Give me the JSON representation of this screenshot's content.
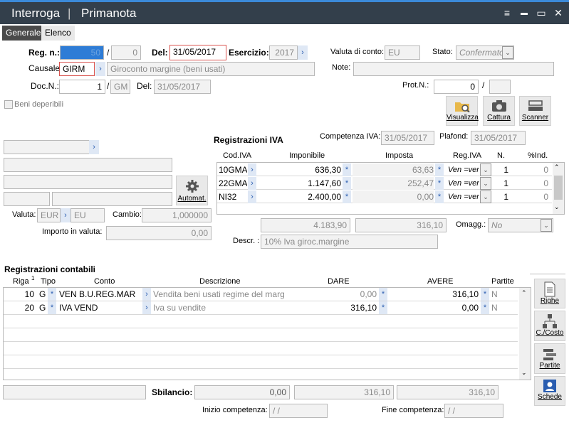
{
  "title": {
    "left": "Interroga",
    "sep": "|",
    "right": "Primanota"
  },
  "window_controls": {
    "menu": "≡",
    "minimize": "▬",
    "restore": "▭",
    "close": "✕"
  },
  "tabs": [
    {
      "label": "Generale"
    },
    {
      "label": "Elenco"
    }
  ],
  "header": {
    "reg_label": "Reg. n.:",
    "reg_value": "50",
    "slash": "/",
    "reg_suffix": "0",
    "del_label": "Del:",
    "del_value": "31/05/2017",
    "esercizio_label": "Esercizio:",
    "esercizio_value": "2017",
    "valuta_conto_label": "Valuta di conto:",
    "valuta_conto_value": "EU",
    "stato_label": "Stato:",
    "stato_value": "Confermato",
    "causale_label": "Causale:",
    "causale_code": "GIRM",
    "causale_desc": "Giroconto margine (beni usati)",
    "note_label": "Note:",
    "doc_label": "Doc.N.:",
    "doc_value": "1",
    "doc_series": "GM",
    "doc_del_label": "Del:",
    "doc_del_value": "31/05/2017",
    "prot_label": "Prot.N.:",
    "prot_value": "0",
    "prot_slash": "/",
    "beni_deperibili": "Beni deperibili"
  },
  "toolbar": {
    "visualizza": "Visualizza",
    "cattura": "Cattura",
    "scanner": "Scanner"
  },
  "left": {
    "automat": "Automat.",
    "valuta_label": "Valuta:",
    "valuta_value": "EUR",
    "valuta_code": "EU",
    "cambio_label": "Cambio:",
    "cambio_value": "1,000000",
    "importo_label": "Importo in valuta:",
    "importo_value": "0,00"
  },
  "iva": {
    "title": "Registrazioni IVA",
    "competenza_label": "Competenza IVA:",
    "competenza_value": "31/05/2017",
    "plafond_label": "Plafond:",
    "plafond_value": "31/05/2017",
    "columns": [
      "Cod.IVA",
      "Imponibile",
      "Imposta",
      "Reg.IVA",
      "N.",
      "%Ind."
    ],
    "rows": [
      {
        "cod": "10GMA",
        "imponibile": "636,30",
        "imposta": "63,63",
        "reg": "Ven =ven",
        "n": "1",
        "ind": "0"
      },
      {
        "cod": "22GMA",
        "imponibile": "1.147,60",
        "imposta": "252,47",
        "reg": "Ven =ven",
        "n": "1",
        "ind": "0"
      },
      {
        "cod": "NI32",
        "imponibile": "2.400,00",
        "imposta": "0,00",
        "reg": "Ven =ven",
        "n": "1",
        "ind": "0"
      }
    ],
    "tot_imponibile": "4.183,90",
    "tot_imposta": "316,10",
    "omagg_label": "Omagg.:",
    "omagg_value": "No",
    "descr_label": "Descr. :",
    "descr_value": "10% Iva giroc.margine"
  },
  "contabili": {
    "title": "Registrazioni contabili",
    "columns": [
      "Riga",
      "Tipo",
      "Conto",
      "Descrizione",
      "DARE",
      "AVERE",
      "Partite"
    ],
    "sort_marker": "1",
    "rows": [
      {
        "riga": "10",
        "tipo": "G",
        "conto": "VEN B.U.REG.MAR",
        "descr": "Vendita beni usati regime del marg",
        "dare": "0,00",
        "avere": "316,10",
        "partite": "N"
      },
      {
        "riga": "20",
        "tipo": "G",
        "conto": "IVA VEND",
        "descr": "Iva su vendite",
        "dare": "316,10",
        "avere": "0,00",
        "partite": "N"
      }
    ],
    "side_buttons": [
      "Righe",
      "C./Costo",
      "Partite",
      "Schede"
    ]
  },
  "footer": {
    "sbilancio_label": "Sbilancio:",
    "sbilancio_value": "0,00",
    "tot_dare": "316,10",
    "tot_avere": "316,10",
    "inizio_label": "Inizio competenza:",
    "inizio_value": "/ /",
    "fine_label": "Fine competenza:",
    "fine_value": "/ /"
  },
  "colors": {
    "titlebar": "#333f4b",
    "accent": "#3b8ad9",
    "link": "#2a5db0",
    "required_border": "#d9534f"
  }
}
